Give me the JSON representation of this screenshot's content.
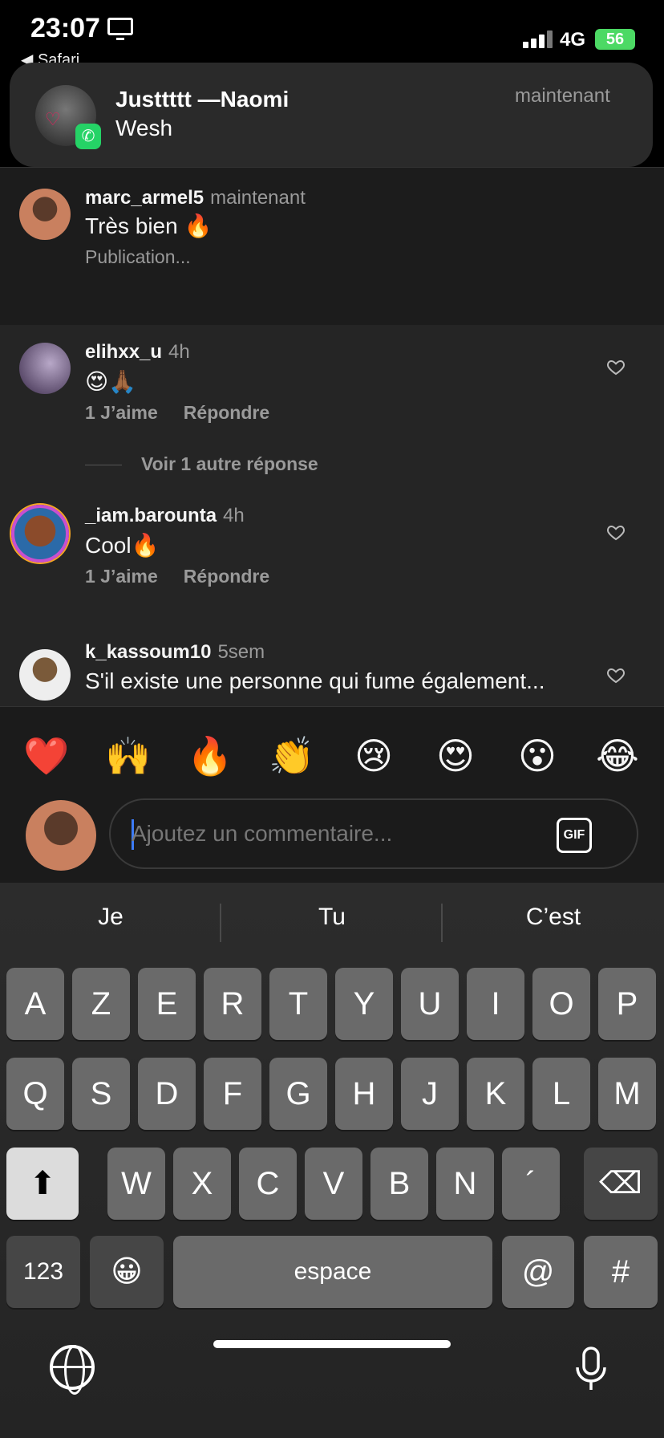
{
  "status": {
    "time": "23:07",
    "back_app": "◀ Safari",
    "network": "4G",
    "battery": "56"
  },
  "notification": {
    "title": "Justtttt —Naomi",
    "body": "Wesh",
    "time": "maintenant",
    "app_icon": "whatsapp-icon"
  },
  "comments": [
    {
      "user": "marc_armel5",
      "time": "maintenant",
      "text": "Très bien 🔥",
      "status": "Publication..."
    },
    {
      "user": "elihxx_u",
      "time": "4h",
      "text": "😍🙏🏾",
      "likes": "1 J’aime",
      "reply": "Répondre",
      "more_replies": "Voir 1 autre réponse"
    },
    {
      "user": "_iam.barounta",
      "time": "4h",
      "text": "Cool🔥",
      "likes": "1 J’aime",
      "reply": "Répondre"
    },
    {
      "user": "k_kassoum10",
      "time": "5sem",
      "text": "S'il existe une personne qui fume également..."
    }
  ],
  "reactions": [
    "❤️",
    "🙌",
    "🔥",
    "👏",
    "😢",
    "😍",
    "😮",
    "😂"
  ],
  "composer": {
    "placeholder": "Ajoutez un commentaire...",
    "gif_label": "GIF"
  },
  "keyboard": {
    "suggestions": [
      "Je",
      "Tu",
      "C’est"
    ],
    "row1": [
      "A",
      "Z",
      "E",
      "R",
      "T",
      "Y",
      "U",
      "I",
      "O",
      "P"
    ],
    "row2": [
      "Q",
      "S",
      "D",
      "F",
      "G",
      "H",
      "J",
      "K",
      "L",
      "M"
    ],
    "row3": [
      "W",
      "X",
      "C",
      "V",
      "B",
      "N",
      "´"
    ],
    "numbers_label": "123",
    "space_label": "espace",
    "at_label": "@",
    "hash_label": "#",
    "emoji_key": "😀",
    "shift_icon": "⬆",
    "delete_icon": "⌫"
  }
}
